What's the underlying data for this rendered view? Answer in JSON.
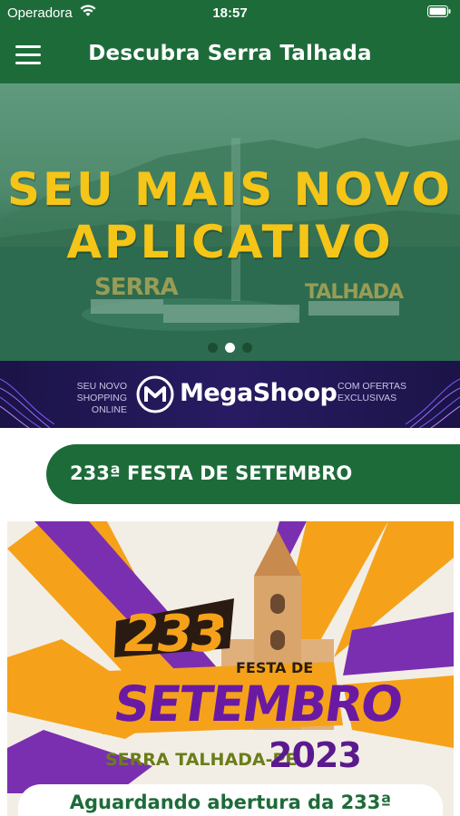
{
  "status_bar": {
    "carrier": "Operadora",
    "time": "18:57",
    "wifi_icon": "wifi-icon",
    "battery_icon": "battery-icon"
  },
  "nav": {
    "title": "Descubra Serra Talhada",
    "menu_icon": "hamburger-menu-icon"
  },
  "hero": {
    "headline_line1": "SEU MAIS NOVO",
    "headline_line2": "APLICATIVO",
    "sign_left": "SERRA",
    "sign_right": "TALHADA",
    "slides_total": 3,
    "active_slide": 2
  },
  "banner": {
    "left_line1": "SEU NOVO",
    "left_line2": "SHOPPING ONLINE",
    "brand": "MegaShoop",
    "right_line1": "COM OFERTAS",
    "right_line2": "EXCLUSIVAS"
  },
  "section": {
    "title": "233ª FESTA DE SETEMBRO"
  },
  "event_card": {
    "number": "233",
    "ordinal": "a",
    "festa_label": "FESTA DE",
    "name": "SETEMBRO",
    "city": "SERRA TALHADA-PE",
    "year": "2023",
    "status_text": "Aguardando abertura da 233ª"
  },
  "colors": {
    "primary_green": "#1e6b3a",
    "headline_yellow": "#f5c518",
    "banner_purple": "#281b63",
    "event_orange": "#f5a21a",
    "event_purple": "#6a1aa2"
  }
}
